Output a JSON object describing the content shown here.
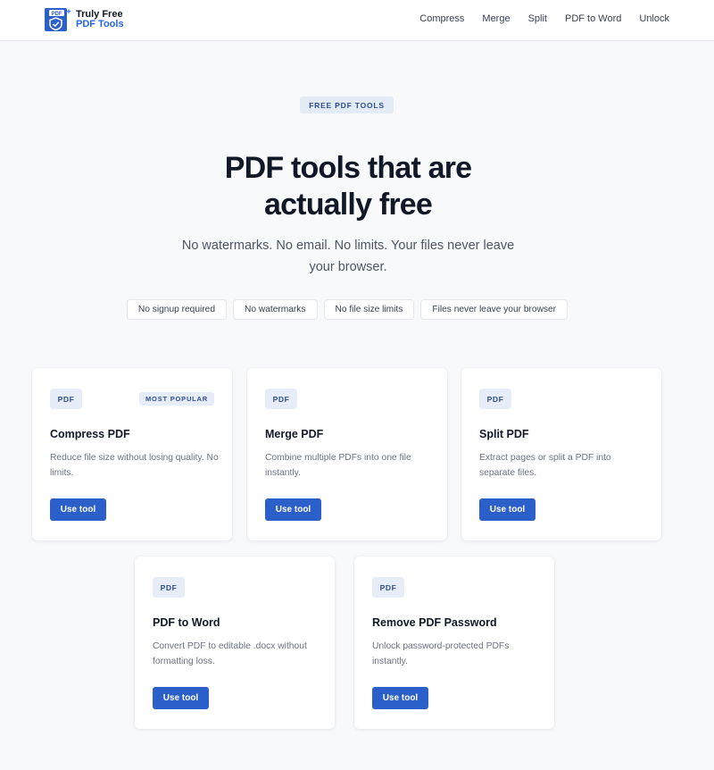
{
  "header": {
    "logo_badge": "PDF",
    "logo_line1": "Truly Free",
    "logo_line2": "PDF Tools",
    "nav": [
      "Compress",
      "Merge",
      "Split",
      "PDF to Word",
      "Unlock"
    ]
  },
  "hero": {
    "badge": "FREE PDF TOOLS",
    "title_line1": "PDF tools that are",
    "title_line2": "actually free",
    "subtitle": "No watermarks. No email. No limits. Your files never leave your browser.",
    "chips": [
      "No signup required",
      "No watermarks",
      "No file size limits",
      "Files never leave your browser"
    ]
  },
  "tools": [
    {
      "tag": "PDF",
      "badge": "MOST POPULAR",
      "title": "Compress PDF",
      "desc": "Reduce file size without losing quality. No limits.",
      "button": "Use tool"
    },
    {
      "tag": "PDF",
      "title": "Merge PDF",
      "desc": "Combine multiple PDFs into one file instantly.",
      "button": "Use tool"
    },
    {
      "tag": "PDF",
      "title": "Split PDF",
      "desc": "Extract pages or split a PDF into separate files.",
      "button": "Use tool"
    },
    {
      "tag": "PDF",
      "title": "PDF to Word",
      "desc": "Convert PDF to editable .docx without formatting loss.",
      "button": "Use tool"
    },
    {
      "tag": "PDF",
      "title": "Remove PDF Password",
      "desc": "Unlock password-protected PDFs instantly.",
      "button": "Use tool"
    }
  ],
  "colors": {
    "accent": "#2b5fc9",
    "background": "#f8f9fb",
    "badge_bg": "#e6edf8"
  },
  "icons": {
    "logo": "shield-check-icon"
  }
}
